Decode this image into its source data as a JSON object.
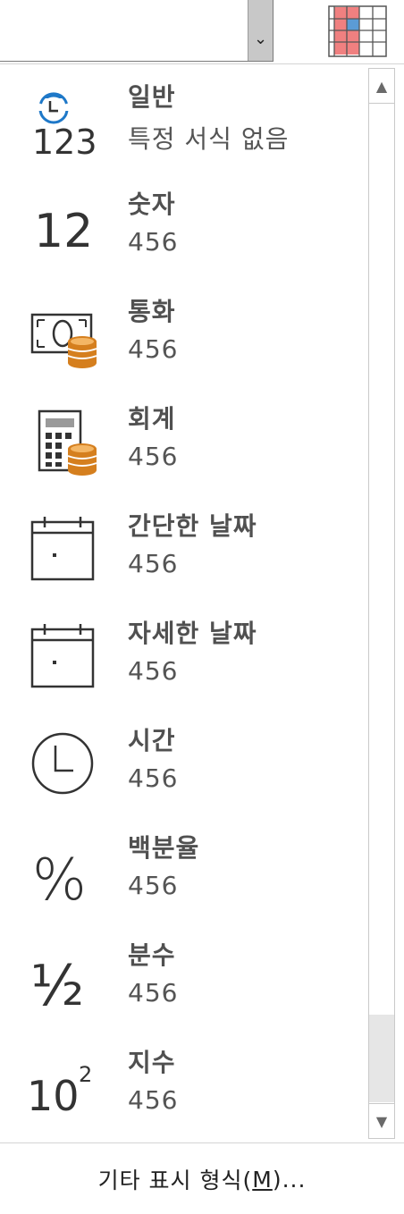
{
  "top_bar": {
    "combo_value": "",
    "combo_arrow_icon": "chevron-down-icon",
    "format_icon": "conditional-formatting-icon"
  },
  "formats": [
    {
      "name": "일반",
      "sample": "특정 서식 없음",
      "icon": "general-clock-123-icon",
      "icon_text": "123"
    },
    {
      "name": "숫자",
      "sample": "456",
      "icon": "number-icon",
      "icon_text": "12"
    },
    {
      "name": "통화",
      "sample": "456",
      "icon": "currency-icon"
    },
    {
      "name": "회계",
      "sample": " 456",
      "icon": "accounting-calculator-icon"
    },
    {
      "name": "간단한 날짜",
      "sample": "456",
      "icon": "short-date-calendar-icon"
    },
    {
      "name": "자세한 날짜",
      "sample": "456",
      "icon": "long-date-calendar-icon"
    },
    {
      "name": "시간",
      "sample": "456",
      "icon": "time-clock-icon"
    },
    {
      "name": "백분율",
      "sample": "456",
      "icon": "percent-icon",
      "icon_text": "%"
    },
    {
      "name": "분수",
      "sample": "456",
      "icon": "fraction-icon",
      "icon_text": "½"
    },
    {
      "name": "지수",
      "sample": "456",
      "icon": "scientific-icon",
      "icon_text": "10",
      "icon_sup": "2"
    }
  ],
  "scrollbar": {
    "up_icon": "▲",
    "down_icon": "▼"
  },
  "more_formats": {
    "prefix": "기타 표시 형식(",
    "mnemonic": "M",
    "suffix": ")..."
  },
  "colors": {
    "accent_blue": "#1e78c8",
    "coin_orange": "#d57f1e",
    "highlight_red": "#f08080",
    "highlight_blue": "#5b9bd5"
  }
}
